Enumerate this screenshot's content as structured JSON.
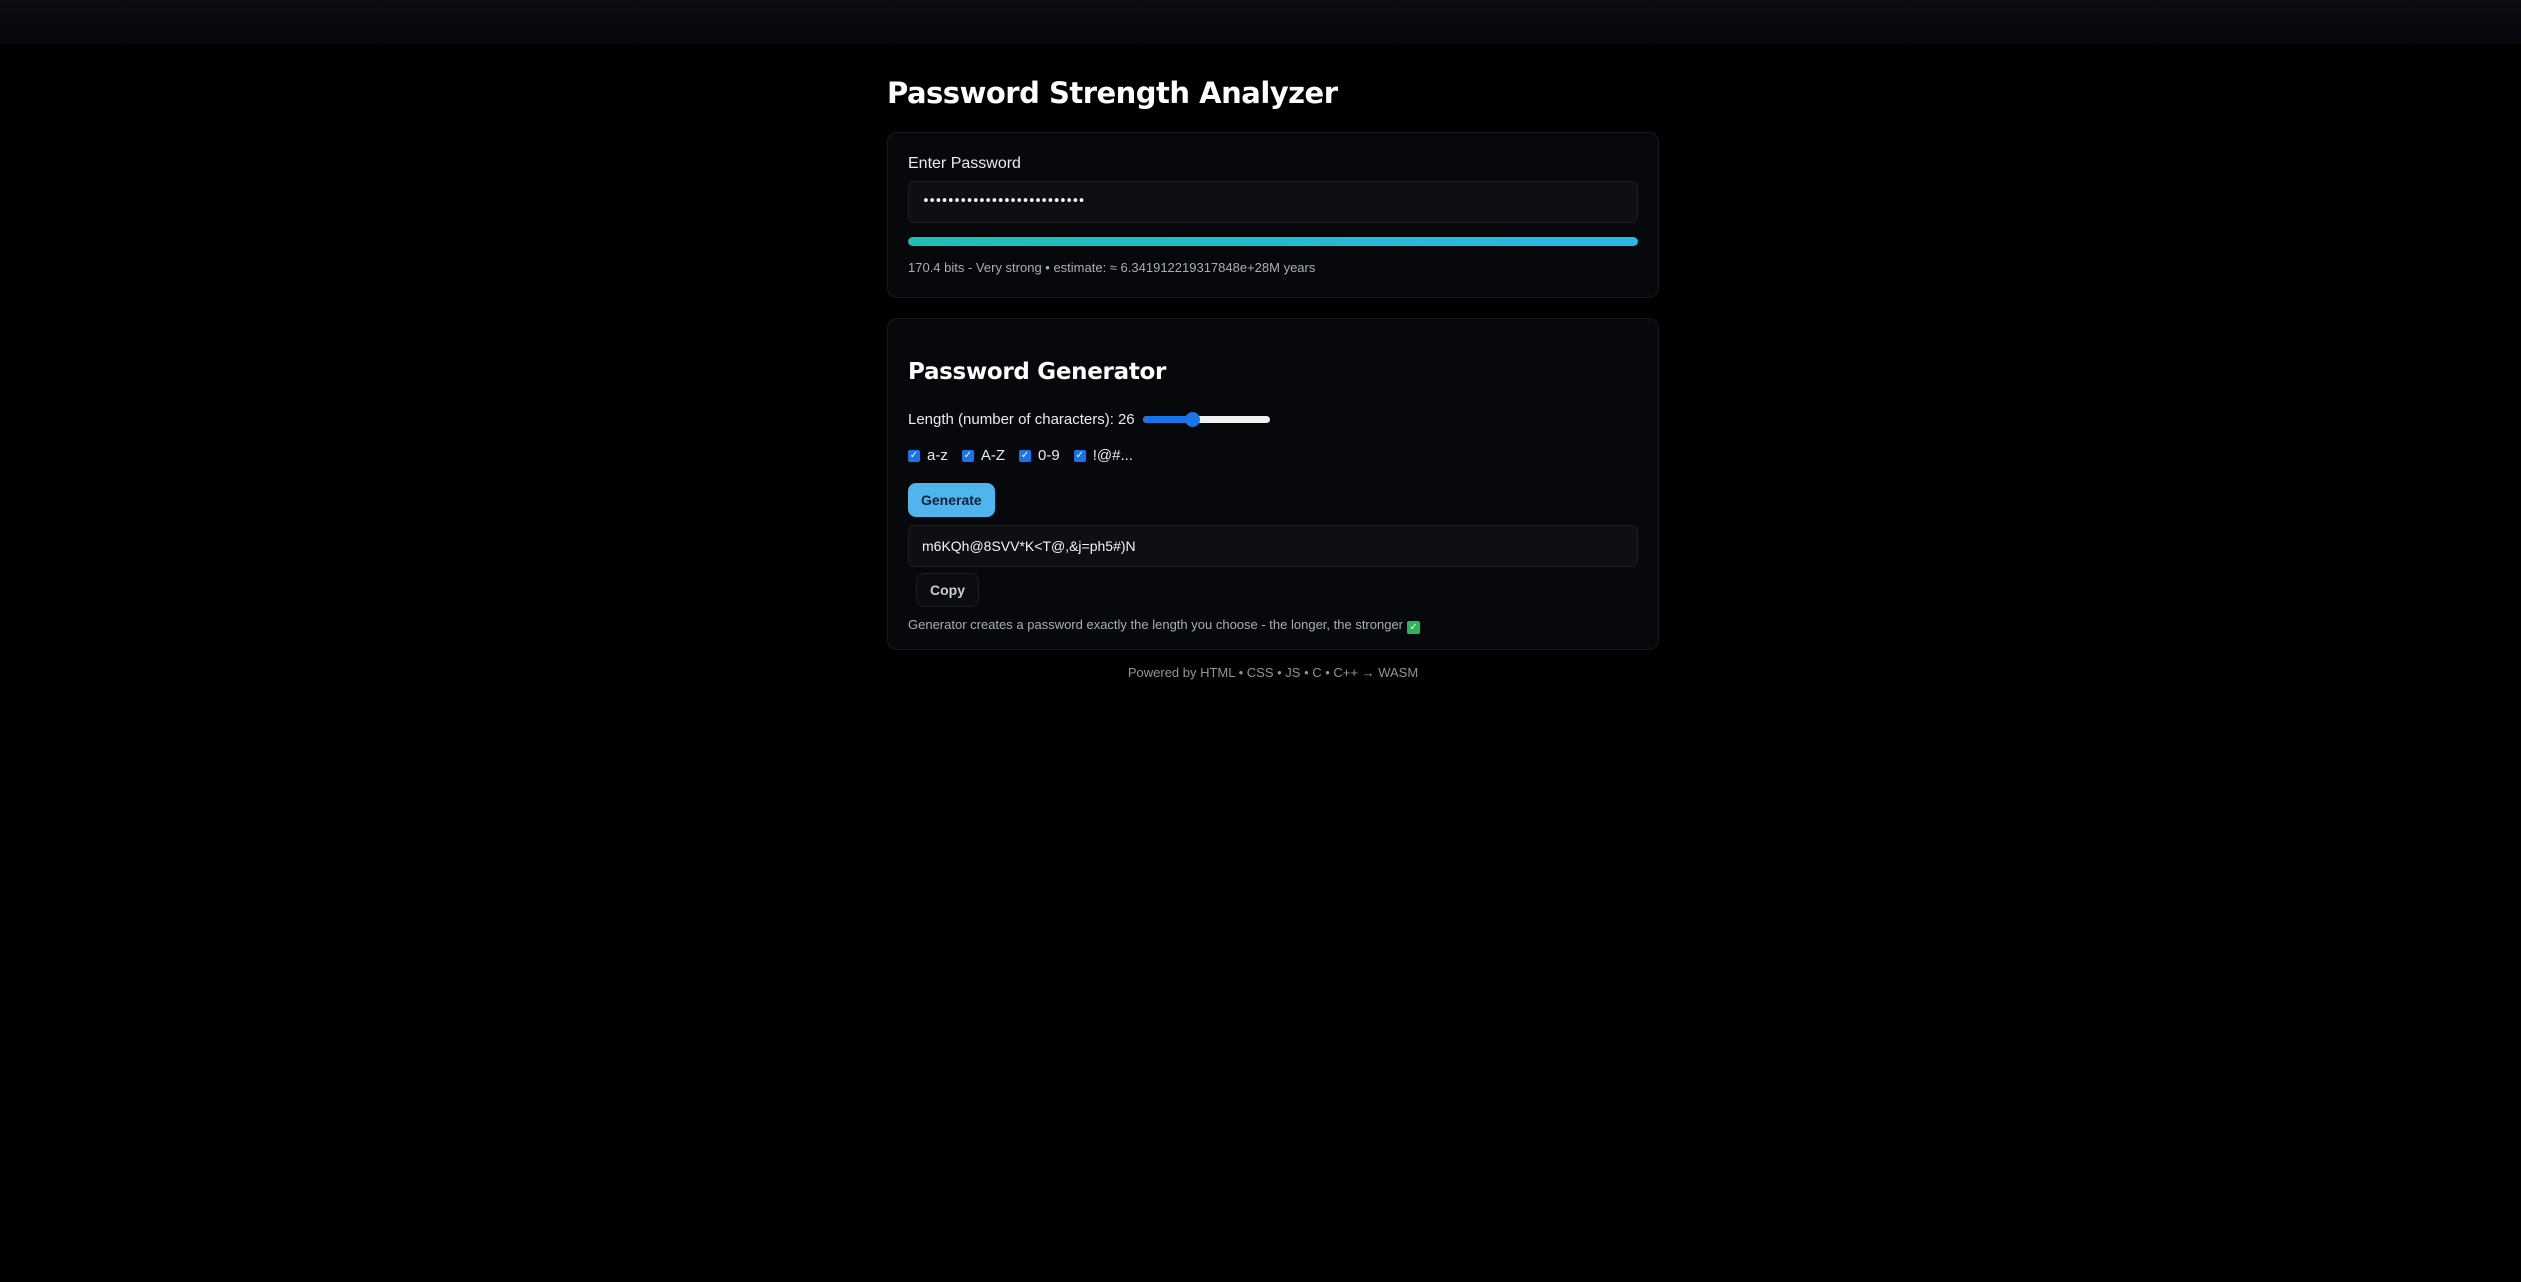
{
  "page": {
    "title": "Password Strength Analyzer",
    "background": "#000000"
  },
  "analyzer": {
    "input_label": "Enter Password",
    "password_masked": "••••••••••••••••••••••••••",
    "strength_fraction": 1.0,
    "strength_colors": [
      "#1fbfb4",
      "#2ab7e8"
    ],
    "strength_info": "170.4 bits - Very strong • estimate: ≈ 6.341912219317848e+28M years"
  },
  "generator": {
    "title": "Password Generator",
    "length_label": "Length (number of characters):",
    "length_value": "26",
    "slider_fraction": 0.39,
    "options": [
      {
        "label": "a-z",
        "checked": true
      },
      {
        "label": "A-Z",
        "checked": true
      },
      {
        "label": "0-9",
        "checked": true
      },
      {
        "label": "!@#...",
        "checked": true
      }
    ],
    "generate_label": "Generate",
    "output": "m6KQh@8SVV*K<T@,&j=ph5#)N",
    "copy_label": "Copy",
    "note": "Generator creates a password exactly the length you choose - the longer, the stronger",
    "note_icon": "check-mark-icon",
    "accent_color": "#4fb5ec"
  },
  "footer": {
    "text": "Powered by HTML • CSS • JS • C • C++ → WASM"
  }
}
